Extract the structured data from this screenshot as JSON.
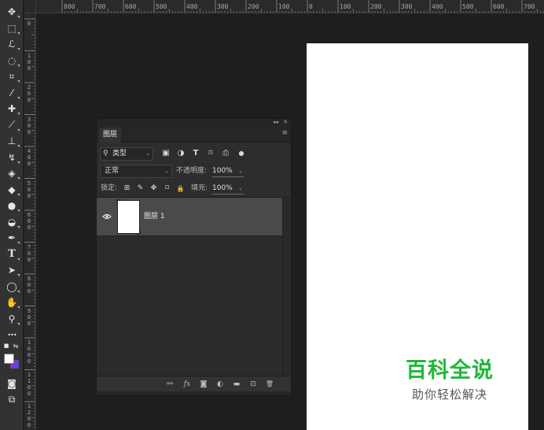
{
  "ruler": {
    "top_labels": [
      "800",
      "700",
      "600",
      "500",
      "400",
      "300",
      "200",
      "100",
      "0",
      "100",
      "200",
      "300",
      "400",
      "500",
      "600",
      "700"
    ],
    "left_labels": [
      "0",
      "100",
      "200",
      "300",
      "400",
      "500",
      "600",
      "700",
      "800",
      "900",
      "1000",
      "1100",
      "1200"
    ]
  },
  "toolbar": {
    "tools": [
      {
        "name": "move-tool",
        "glyph": "✥"
      },
      {
        "name": "marquee-tool",
        "glyph": "⬚"
      },
      {
        "name": "lasso-tool",
        "glyph": "ℒ"
      },
      {
        "name": "quick-select-tool",
        "glyph": "◌"
      },
      {
        "name": "crop-tool",
        "glyph": "⌗"
      },
      {
        "name": "eyedropper-tool",
        "glyph": "⁄"
      },
      {
        "name": "healing-brush-tool",
        "glyph": "✚"
      },
      {
        "name": "brush-tool",
        "glyph": "⟋"
      },
      {
        "name": "clone-stamp-tool",
        "glyph": "⊥"
      },
      {
        "name": "history-brush-tool",
        "glyph": "↯"
      },
      {
        "name": "eraser-tool",
        "glyph": "◈"
      },
      {
        "name": "paint-bucket-tool",
        "glyph": "◆"
      },
      {
        "name": "blur-tool",
        "glyph": "●"
      },
      {
        "name": "dodge-tool",
        "glyph": "◒"
      },
      {
        "name": "pen-tool",
        "glyph": "✒"
      },
      {
        "name": "type-tool",
        "glyph": "T"
      },
      {
        "name": "path-select-tool",
        "glyph": "➤"
      },
      {
        "name": "ellipse-tool",
        "glyph": "◯"
      },
      {
        "name": "hand-tool",
        "glyph": "✋"
      },
      {
        "name": "zoom-tool",
        "glyph": "⚲"
      },
      {
        "name": "more-tools",
        "glyph": "•••"
      }
    ],
    "foreground_color": "#ffffff",
    "background_color": "#6b3fd6",
    "swap_glyph": "⇆",
    "quickmask_glyph": "◙",
    "screenmode_glyph": "⧉"
  },
  "panel": {
    "top_controls": [
      "◂◂",
      "✕"
    ],
    "tab_label": "图层",
    "menu_glyph": "≡",
    "filter": {
      "icon": "⚲",
      "label": "类型",
      "caret": "⌄"
    },
    "filter_icons": [
      "▣",
      "◑",
      "T",
      "⌑",
      "⎙",
      "●"
    ],
    "blend_mode": "正常",
    "opacity_label": "不透明度:",
    "opacity_value": "100%",
    "lock_label": "锁定:",
    "lock_icons": [
      "⊞",
      "✎",
      "✥",
      "⌑",
      "🔒"
    ],
    "fill_label": "填充:",
    "fill_value": "100%",
    "caret": "⌄",
    "layers": [
      {
        "name": "图层 1",
        "visible_glyph": "👁"
      }
    ],
    "bottom_icons": [
      "⚯",
      "fx",
      "◙",
      "◐",
      "▬",
      "⊡",
      "🗑"
    ]
  },
  "watermark": {
    "title": "百科全说",
    "subtitle": "助你轻松解决"
  },
  "colors": {
    "workspace": "#1e1e1e",
    "document": "#ffffff",
    "accent_green": "#1fb839"
  }
}
